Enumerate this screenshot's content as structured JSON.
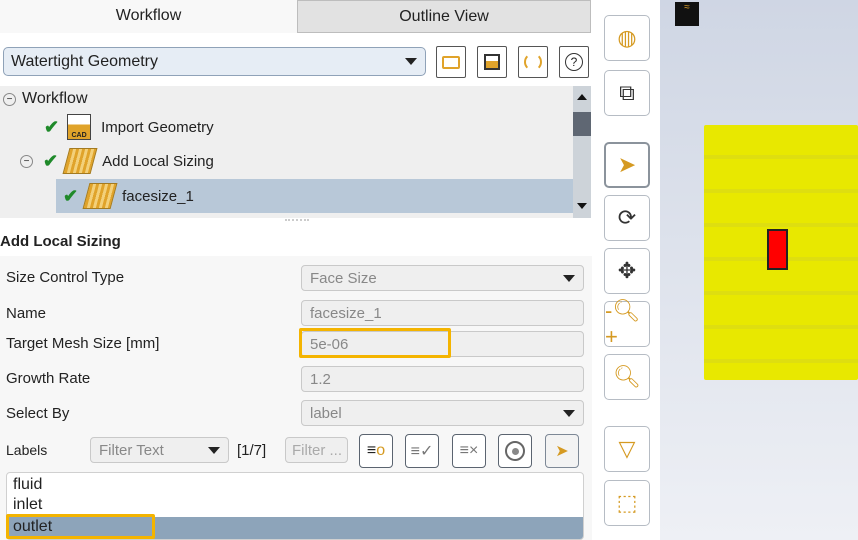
{
  "tabs": [
    {
      "label": "Workflow",
      "active": true
    },
    {
      "label": "Outline View",
      "active": false
    }
  ],
  "workflow_select": {
    "value": "Watertight Geometry"
  },
  "tree": {
    "root": "Workflow",
    "items": [
      {
        "label": "Import Geometry",
        "status": "done"
      },
      {
        "label": "Add Local Sizing",
        "status": "done"
      },
      {
        "label": "facesize_1",
        "status": "done",
        "selected": true
      }
    ]
  },
  "panel": {
    "title": "Add Local Sizing",
    "fields": [
      {
        "label": "Size Control Type",
        "value": "Face Size"
      },
      {
        "label": "Name",
        "value": "facesize_1"
      },
      {
        "label": "Target Mesh Size [mm]",
        "value": "5e-06"
      },
      {
        "label": "Growth Rate",
        "value": "1.2"
      },
      {
        "label": "Select By",
        "value": "label"
      }
    ],
    "labels": {
      "label": "Labels",
      "filter_select": "Filter Text",
      "count": "[1/7]",
      "filter_placeholder": "Filter ...",
      "items": [
        "fluid",
        "inlet",
        "outlet"
      ],
      "selected": "outlet"
    }
  },
  "colors": {
    "highlight": "#f4b400",
    "selection": "#8da4ba",
    "geometry": "#e8e800",
    "boundary": "#ff0000"
  }
}
